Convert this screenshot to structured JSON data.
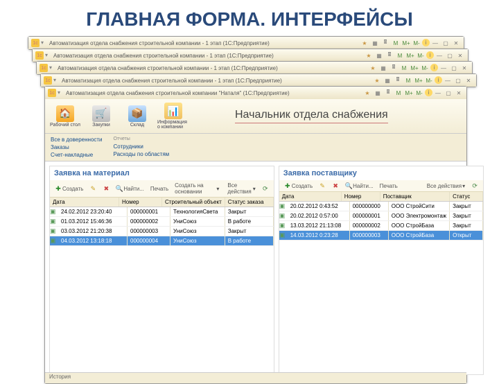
{
  "slideTitle": "ГЛАВНАЯ ФОРМА. ИНТЕРФЕЙСЫ",
  "winTitle": "Автоматизация отдела снабжения строительной компании - 1 этап (1С:Предприятие)",
  "frontTitle": "Автоматизация отдела снабжения строительной компании \"Наталя\" (1С:Предприятие)",
  "tctrls": {
    "m": "M",
    "mp": "M+",
    "mm": "M-"
  },
  "bigbtns": {
    "home": "Рабочий стол",
    "purch": "Закупки",
    "stock": "Склад",
    "info": "Информация о компании"
  },
  "roleLabel": "Начальник отдела снабжения",
  "sub": {
    "h1": "",
    "a1": "Все в доверенности",
    "a2": "Заказы",
    "a3": "Счет-накладные",
    "h2": "Отчеты",
    "b1": "Сотрудники",
    "b2": "Расходы по областям"
  },
  "left": {
    "title": "Заявка на материал",
    "tb": {
      "create": "Создать",
      "find": "Найти...",
      "print": "Печать",
      "base": "Создать на основании",
      "all": "Все действия"
    },
    "cols": {
      "date": "Дата",
      "num": "Номер",
      "obj": "Строительный объект",
      "stat": "Статус заказа"
    },
    "rows": [
      {
        "date": "24.02.2012 23:20:40",
        "num": "000000001",
        "obj": "ТехнологияСвета",
        "stat": "Закрыт"
      },
      {
        "date": "01.03.2012 15:46:36",
        "num": "000000002",
        "obj": "УниСоюз",
        "stat": "В работе"
      },
      {
        "date": "03.03.2012 21:20:38",
        "num": "000000003",
        "obj": "УниСоюз",
        "stat": "Закрыт"
      },
      {
        "date": "04.03.2012 13:18:18",
        "num": "000000004",
        "obj": "УниСоюз",
        "stat": "В работе",
        "sel": true
      }
    ]
  },
  "right": {
    "title": "Заявка поставщику",
    "tb": {
      "create": "Создать",
      "find": "Найти...",
      "print": "Печать",
      "all": "Все действия"
    },
    "cols": {
      "date": "Дата",
      "num": "Номер",
      "post": "Поставщик",
      "stat": "Статус"
    },
    "rows": [
      {
        "date": "20.02.2012 0:43:52",
        "num": "000000000",
        "post": "ООО СтройСити",
        "stat": "Закрыт"
      },
      {
        "date": "20.02.2012 0:57:00",
        "num": "000000001",
        "post": "ООО Электромонтаж",
        "stat": "Закрыт"
      },
      {
        "date": "13.03.2012 21:13:08",
        "num": "000000002",
        "post": "ООО СтройБаза",
        "stat": "Закрыт"
      },
      {
        "date": "14.03.2012 0:23:28",
        "num": "000000003",
        "post": "ООО СтройБаза",
        "stat": "Открыт",
        "sel": true
      }
    ]
  },
  "status": "История"
}
